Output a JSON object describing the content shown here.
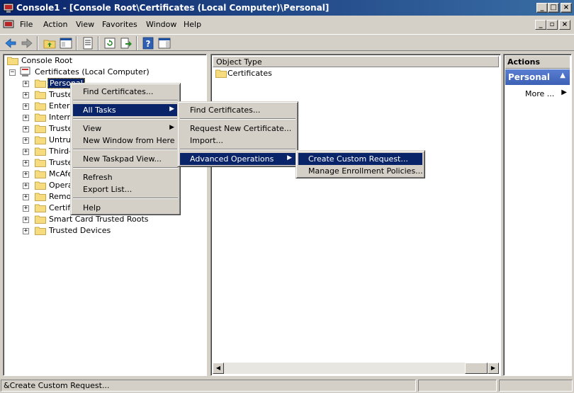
{
  "window": {
    "title": "Console1 - [Console Root\\Certificates (Local Computer)\\Personal]",
    "title_bar_color": "#0a246a"
  },
  "caption_buttons": [
    "_",
    "□",
    "×"
  ],
  "menubar": {
    "items": [
      "File",
      "Action",
      "View",
      "Favorites",
      "Window",
      "Help"
    ],
    "mdi_buttons": [
      "_",
      "▫",
      "×"
    ]
  },
  "toolbar": {
    "buttons": [
      "back-icon",
      "forward-icon",
      "up-folder-icon",
      "show-hide-tree-icon",
      "properties-icon",
      "refresh-icon",
      "export-list-icon",
      "help-icon",
      "show-hide-action-pane-icon"
    ]
  },
  "tree": {
    "root": "Console Root",
    "computer": "Certificates (Local Computer)",
    "items": [
      {
        "label": "Personal",
        "selected": true
      },
      {
        "label": "Truste"
      },
      {
        "label": "Enterp"
      },
      {
        "label": "Interm"
      },
      {
        "label": "Truste"
      },
      {
        "label": "Untrus"
      },
      {
        "label": "Third-P"
      },
      {
        "label": "Truste"
      },
      {
        "label": "McAfe"
      },
      {
        "label": "Opera"
      },
      {
        "label": "Remot"
      },
      {
        "label": "Certific"
      },
      {
        "label": "Smart Card Trusted Roots"
      },
      {
        "label": "Trusted Devices"
      }
    ]
  },
  "list": {
    "column_header": "Object Type",
    "rows": [
      "Certificates"
    ]
  },
  "actions": {
    "header": "Actions",
    "section": "Personal",
    "more": "More ..."
  },
  "context_menu": {
    "items": {
      "find": "Find Certificates...",
      "all_tasks": "All Tasks",
      "view": "View",
      "new_window": "New Window from Here",
      "new_taskpad": "New Taskpad View...",
      "refresh": "Refresh",
      "export": "Export List...",
      "help": "Help"
    }
  },
  "all_tasks_menu": {
    "find": "Find Certificates...",
    "request_new": "Request New Certificate...",
    "import": "Import...",
    "advanced": "Advanced Operations"
  },
  "advanced_menu": {
    "create_custom": "Create Custom Request...",
    "manage_policies": "Manage Enrollment Policies..."
  },
  "statusbar": {
    "text": "&Create Custom Request..."
  },
  "colors": {
    "highlight": "#0a246a",
    "face": "#d4d0c8",
    "actions_section": "#3c61b5"
  }
}
